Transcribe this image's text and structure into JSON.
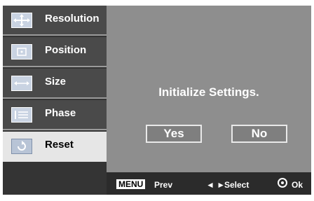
{
  "menu": {
    "items": [
      {
        "label": "Resolution",
        "icon": "resolution-icon"
      },
      {
        "label": "Position",
        "icon": "position-icon"
      },
      {
        "label": "Size",
        "icon": "size-icon"
      },
      {
        "label": "Phase",
        "icon": "phase-icon"
      },
      {
        "label": "Reset",
        "icon": "reset-icon",
        "active": true
      }
    ]
  },
  "dialog": {
    "title": "Initialize Settings.",
    "yes_label": "Yes",
    "no_label": "No"
  },
  "footer": {
    "menu_key": "MENU",
    "prev_label": "Prev",
    "select_arrows": "◄ ►",
    "select_label": "Select",
    "ok_label": "Ok"
  },
  "colors": {
    "sidebar_item": "#4a4a4a",
    "sidebar_active": "#e6e6e6",
    "main_bg": "#8e8e8e",
    "footer_bg": "#2b2b2b"
  }
}
